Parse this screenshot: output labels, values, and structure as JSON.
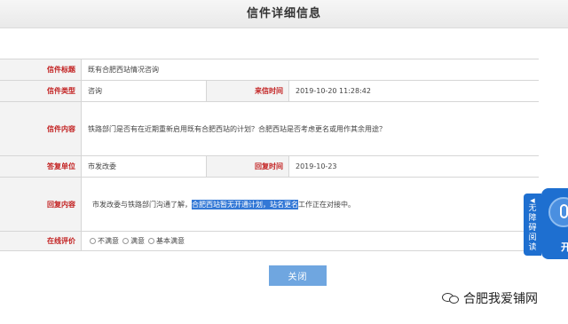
{
  "header": {
    "title": "信件详细信息"
  },
  "letter": {
    "subject_label": "信件标题",
    "subject": "既有合肥西站情况咨询",
    "type_label": "信件类型",
    "type": "咨询",
    "received_label": "来信时间",
    "received": "2019-10-20 11:28:42",
    "content_label": "信件内容",
    "content": "铁路部门是否有在近期重新启用既有合肥西站的计划？合肥西站是否考虑更名或用作其余用途？",
    "reply_unit_label": "答复单位",
    "reply_unit": "市发改委",
    "reply_time_label": "回复时间",
    "reply_time": "2019-10-23",
    "reply_content_label": "回复内容",
    "reply_before": "市发改委与铁路部门沟通了解，",
    "reply_highlight": "合肥西站暂无开通计划，站名更名",
    "reply_after": "工作正在对接中。",
    "rating_label": "在线评价",
    "rating_options": [
      "不满意",
      "满意",
      "基本满意"
    ]
  },
  "actions": {
    "close_label": "关闭"
  },
  "accessibility": {
    "tab_label_chars": [
      "无",
      "障",
      "碍",
      "阅",
      "读"
    ],
    "widget_label": "开"
  },
  "watermark": {
    "text": "合肥我爱铺网"
  },
  "colors": {
    "label_red": "#c21f1f",
    "button_blue": "#6fa6e0",
    "highlight_blue": "#3378d6",
    "widget_blue": "#1e6fd0"
  }
}
